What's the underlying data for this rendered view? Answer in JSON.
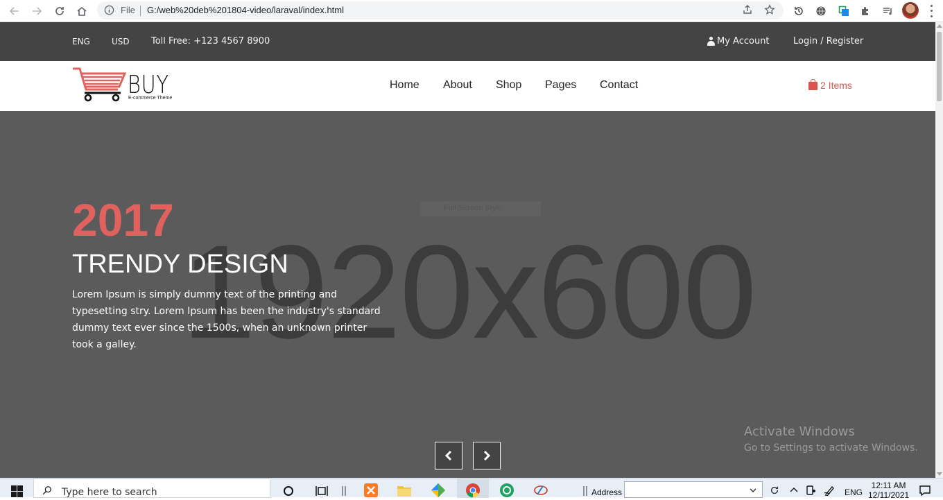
{
  "browser": {
    "scheme_label": "File",
    "url": "G:/web%20deb%201804-video/laraval/index.html"
  },
  "topbar": {
    "language": "ENG",
    "currency": "USD",
    "toll_free": "Toll Free: +123 4567 8900",
    "my_account": "My Account",
    "login_register": "Login / Register"
  },
  "header": {
    "logo_text": "BUY",
    "logo_subtitle": "E-commerce Theme",
    "menu": [
      "Home",
      "About",
      "Shop",
      "Pages",
      "Contact"
    ],
    "cart_label": "2 Items"
  },
  "hero": {
    "year": "2017",
    "title": "TRENDY DESIGN",
    "description": "Lorem Ipsum is simply dummy text of the printing and typesetting stry. Lorem Ipsum has been the industry's standard dummy text ever since the 1500s, when an unknown printer took a galley.",
    "placeholder_size": "1920x600",
    "placeholder_small": "Full-Screen Style"
  },
  "watermark": {
    "line1": "Activate Windows",
    "line2": "Go to Settings to activate Windows."
  },
  "taskbar": {
    "search_placeholder": "Type here to search",
    "address_label": "Address",
    "language": "ENG",
    "time": "12:11 AM",
    "date": "12/11/2021"
  },
  "colors": {
    "accent": "#e0625e",
    "topbar_bg": "#444444",
    "hero_bg": "#5b5b5b"
  }
}
